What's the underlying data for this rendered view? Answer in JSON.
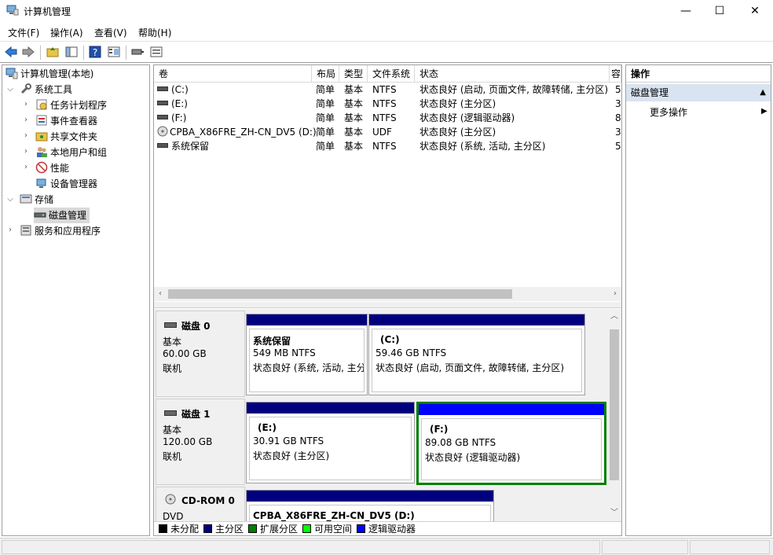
{
  "window": {
    "title": "计算机管理",
    "minimize": "—",
    "maximize": "☐",
    "close": "✕"
  },
  "menu": [
    "文件(F)",
    "操作(A)",
    "查看(V)",
    "帮助(H)"
  ],
  "tree": {
    "root": "计算机管理(本地)",
    "system_tools": "系统工具",
    "task_scheduler": "任务计划程序",
    "event_viewer": "事件查看器",
    "shared_folders": "共享文件夹",
    "local_users": "本地用户和组",
    "performance": "性能",
    "device_manager": "设备管理器",
    "storage": "存储",
    "disk_management": "磁盘管理",
    "services_apps": "服务和应用程序"
  },
  "volume_list": {
    "columns": [
      "卷",
      "布局",
      "类型",
      "文件系统",
      "状态",
      "容"
    ],
    "rows": [
      {
        "volume": "(C:)",
        "layout": "简单",
        "type": "基本",
        "fs": "NTFS",
        "status": "状态良好 (启动, 页面文件, 故障转储, 主分区)",
        "cap": "5"
      },
      {
        "volume": "(E:)",
        "layout": "简单",
        "type": "基本",
        "fs": "NTFS",
        "status": "状态良好 (主分区)",
        "cap": "3"
      },
      {
        "volume": "(F:)",
        "layout": "简单",
        "type": "基本",
        "fs": "NTFS",
        "status": "状态良好 (逻辑驱动器)",
        "cap": "8"
      },
      {
        "volume": "CPBA_X86FRE_ZH-CN_DV5 (D:)",
        "layout": "简单",
        "type": "基本",
        "fs": "UDF",
        "status": "状态良好 (主分区)",
        "cap": "3"
      },
      {
        "volume": "系统保留",
        "layout": "简单",
        "type": "基本",
        "fs": "NTFS",
        "status": "状态良好 (系统, 活动, 主分区)",
        "cap": "5"
      }
    ]
  },
  "disks": [
    {
      "name": "磁盘 0",
      "kind": "基本",
      "size": "60.00 GB",
      "state": "联机",
      "partitions": [
        {
          "title": "系统保留",
          "size": "549 MB NTFS",
          "status": "状态良好 (系统, 活动, 主分"
        },
        {
          "title": "(C:)",
          "size": "59.46 GB NTFS",
          "status": "状态良好 (启动, 页面文件, 故障转储, 主分区)"
        }
      ]
    },
    {
      "name": "磁盘 1",
      "kind": "基本",
      "size": "120.00 GB",
      "state": "联机",
      "partitions": [
        {
          "title": "(E:)",
          "size": "30.91 GB NTFS",
          "status": "状态良好 (主分区)"
        },
        {
          "title": "(F:)",
          "size": "89.08 GB NTFS",
          "status": "状态良好 (逻辑驱动器)"
        }
      ]
    },
    {
      "name": "CD-ROM 0",
      "kind": "DVD",
      "partitions": [
        {
          "title": "CPBA_X86FRE_ZH-CN_DV5  (D:)"
        }
      ]
    }
  ],
  "legend": [
    {
      "label": "未分配",
      "color": "#000000"
    },
    {
      "label": "主分区",
      "color": "#00007f"
    },
    {
      "label": "扩展分区",
      "color": "#007f00"
    },
    {
      "label": "可用空间",
      "color": "#00ff00"
    },
    {
      "label": "逻辑驱动器",
      "color": "#0000ff"
    }
  ],
  "actions": {
    "header": "操作",
    "section": "磁盘管理",
    "more": "更多操作"
  }
}
